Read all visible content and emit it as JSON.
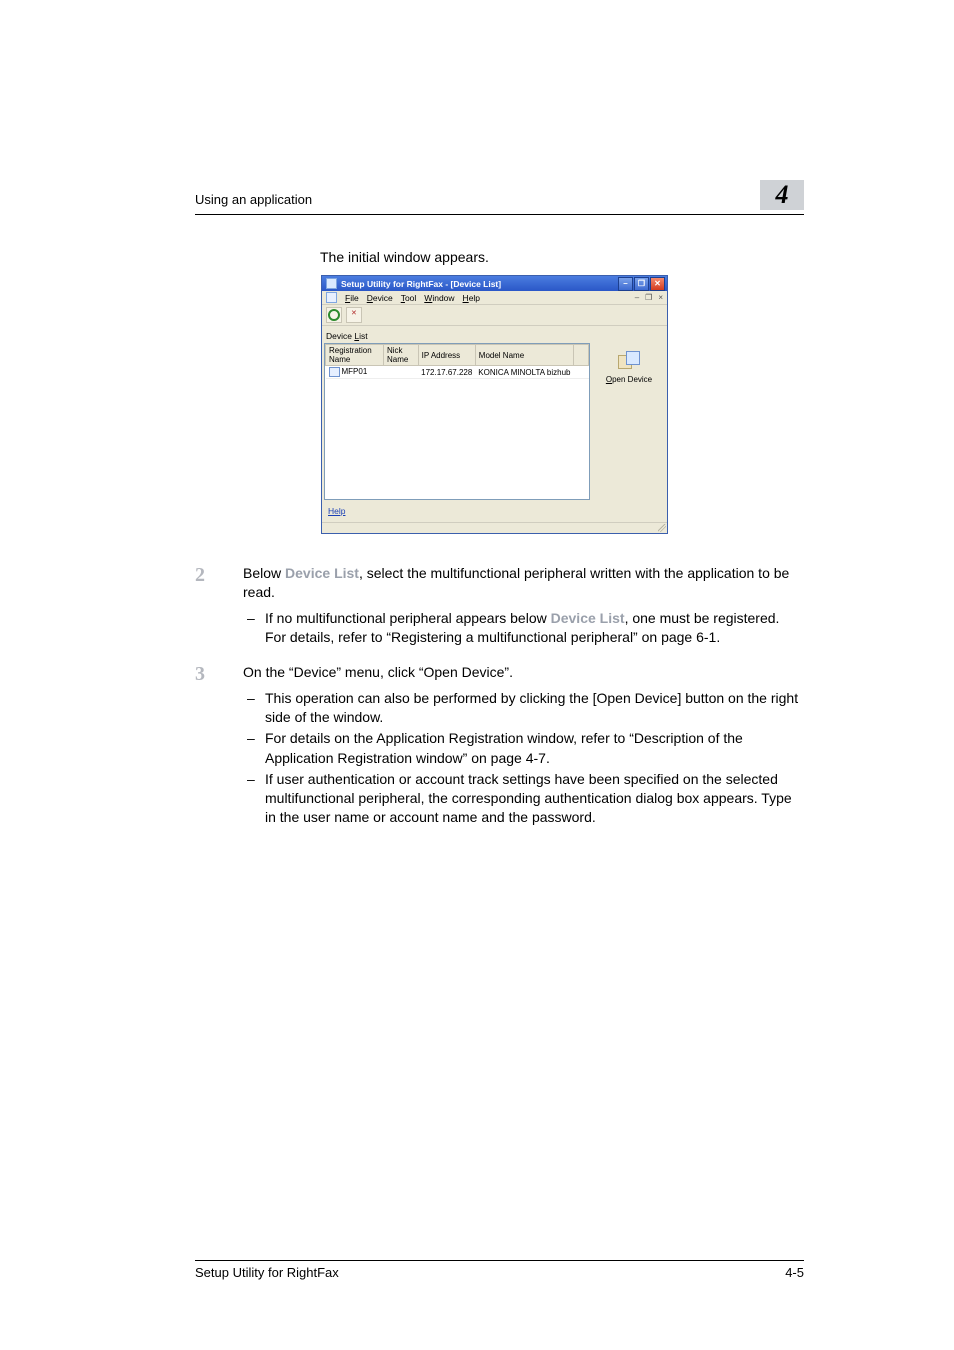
{
  "header": {
    "section_title": "Using an application",
    "chapter_number": "4"
  },
  "intro": "The initial window appears.",
  "app": {
    "title": "Setup Utility for RightFax - [Device List]",
    "menus": {
      "file": {
        "pre": "",
        "u": "F",
        "post": "ile"
      },
      "device": {
        "pre": "",
        "u": "D",
        "post": "evice"
      },
      "tool": {
        "pre": "",
        "u": "T",
        "post": "ool"
      },
      "window": {
        "pre": "",
        "u": "W",
        "post": "indow"
      },
      "help": {
        "pre": "",
        "u": "H",
        "post": "elp"
      }
    },
    "mdi": {
      "min": "–",
      "restore": "❐",
      "close": "×"
    },
    "win": {
      "min": "–",
      "max": "❐",
      "close": "✕"
    },
    "devlist_label": {
      "pre": "Device ",
      "u": "L",
      "post": "ist"
    },
    "columns": {
      "reg": "Registration Name",
      "nick": "Nick Name",
      "ip": "IP Address",
      "model": "Model Name"
    },
    "rows": {
      "r0": {
        "reg": "MFP01",
        "nick": "",
        "ip": "172.17.67.228",
        "model": "KONICA MINOLTA bizhub"
      }
    },
    "open_device": {
      "pre": "",
      "u": "O",
      "post": "pen Device"
    },
    "help_link": "Help"
  },
  "steps": {
    "s2": {
      "num": "2",
      "body_a": "Below ",
      "body_ref": "Device List",
      "body_b": ", select the multifunctional peripheral written with the application to be read.",
      "sub1_a": "If no multifunctional peripheral appears below ",
      "sub1_ref": "Device List",
      "sub1_b": ", one must be registered. For details, refer to “Registering a multifunctional peripheral” on page 6-1."
    },
    "s3": {
      "num": "3",
      "body": "On the “Device” menu, click “Open Device”.",
      "sub1": "This operation can also be performed by clicking the [Open Device] button on the right side of the window.",
      "sub2": "For details on the Application Registration window, refer to “Description of the Application Registration window” on page 4-7.",
      "sub3": "If user authentication or account track settings have been specified on the selected multifunctional peripheral, the corresponding authentication dialog box appears. Type in the user name or account name and the password."
    }
  },
  "footer": {
    "left": "Setup Utility for RightFax",
    "right": "4-5"
  }
}
